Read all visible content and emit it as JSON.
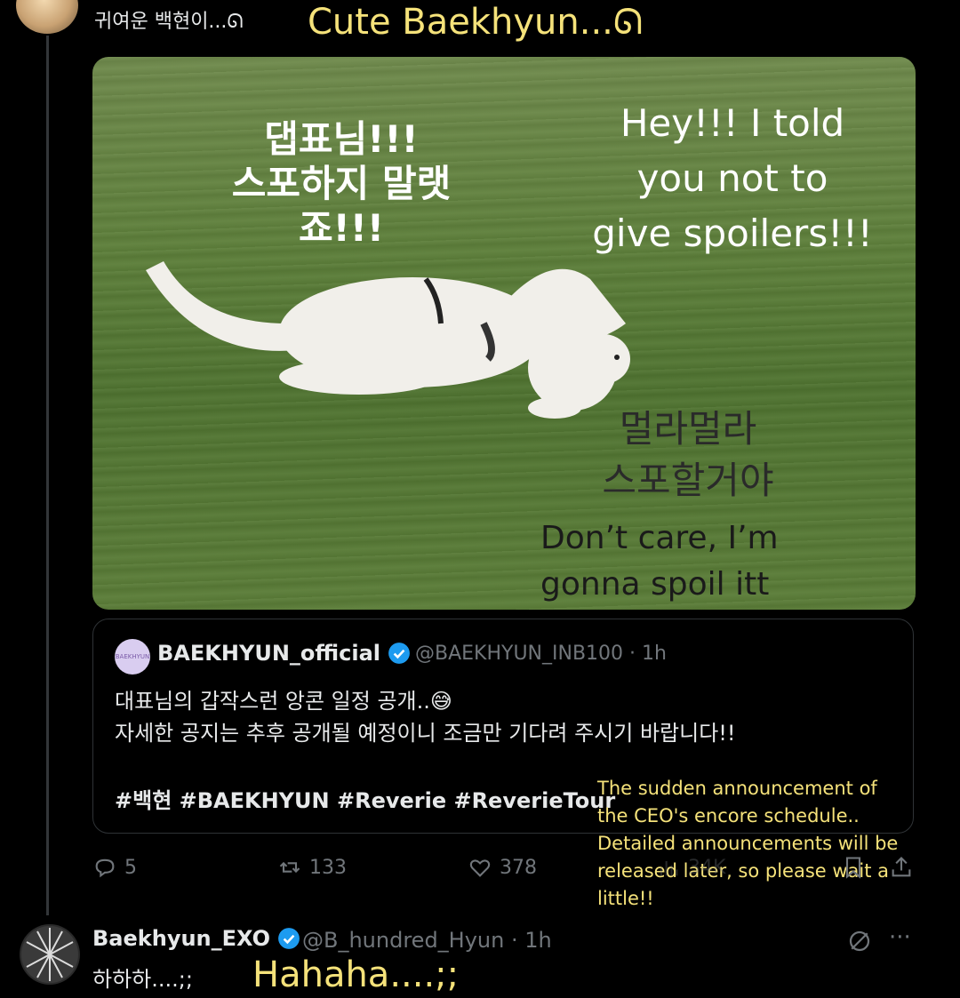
{
  "top_post": {
    "author_display": "귀여운 백현이...ᘏ",
    "translation": "Cute Baekhyun...ᘏ"
  },
  "media": {
    "text_ko_1": "댑표님!!!\n스포하지 말랫죠!!!",
    "text_en_1": "Hey!!! I told\nyou not to\ngive spoilers!!!",
    "text_ko_2": "멀라멀라\n스포할거야",
    "text_en_2": "Don’t care, I’m\ngonna spoil itt"
  },
  "quote": {
    "avatar_label": "BAEKHYUN",
    "name": "BAEKHYUN_official",
    "handle": "@BAEKHYUN_INB100 · 1h",
    "body_line1": "대표님의 갑작스런 앙콘 일정 공개..😅",
    "body_line2": "자세한 공지는 추후 공개될 예정이니 조금만 기다려 주시기 바랍니다!!",
    "hashtags": "#백현 #BAEKHYUN #Reverie #ReverieTour",
    "translation": "The sudden announcement of the CEO's encore schedule.. Detailed announcements will be released later, so please wait a little!!"
  },
  "actions": {
    "replies": "5",
    "reposts": "133",
    "likes": "378",
    "views": "34K"
  },
  "reply_post": {
    "name": "Baekhyun_EXO",
    "handle": "@B_hundred_Hyun · 1h",
    "text": "하하하....;;",
    "translation": "Hahaha....;;",
    "more": "···"
  },
  "colors": {
    "background": "#000000",
    "translation_yellow": "#f5e27a",
    "verified_blue": "#1d9bf0",
    "muted": "#71767b",
    "border": "#2f3336"
  }
}
